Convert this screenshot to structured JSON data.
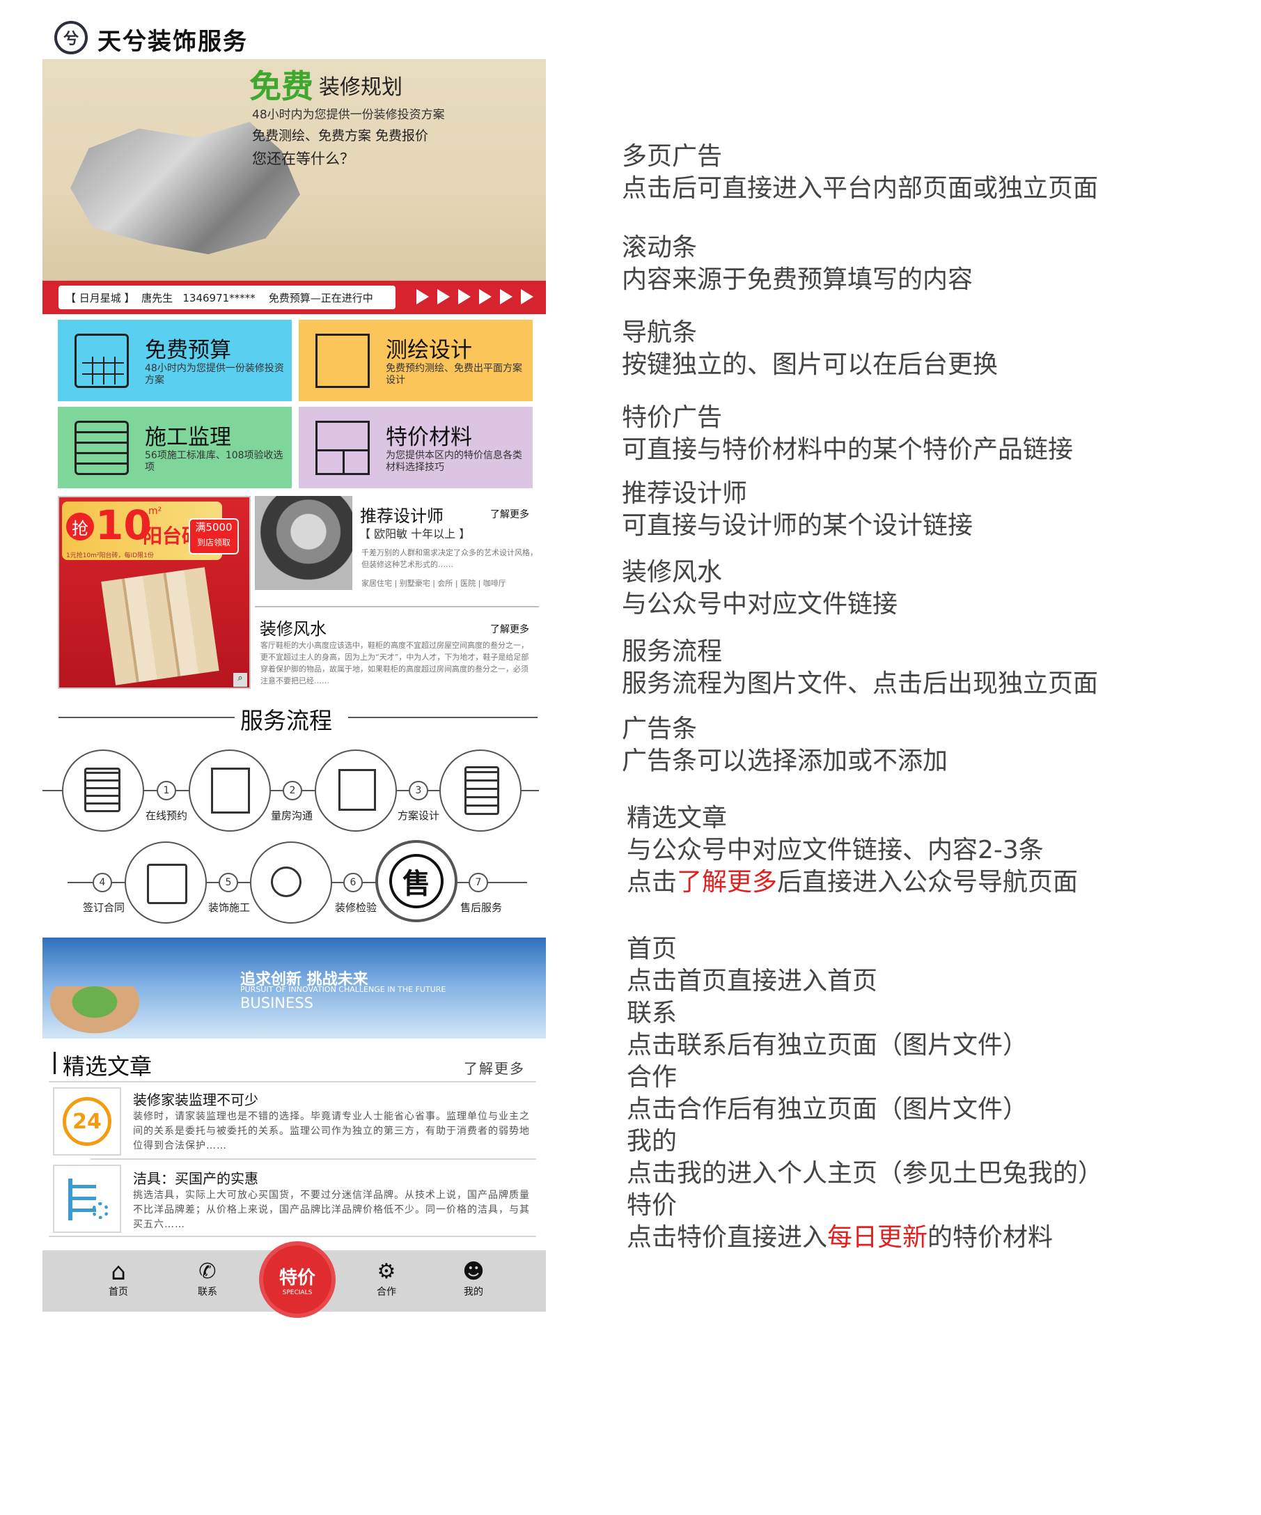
{
  "header": {
    "logo_char": "兮",
    "title": "天兮装饰服务"
  },
  "banner": {
    "title_green": "免费",
    "title_rest": "装修规划",
    "subtitle": "48小时内为您提供一份装修投资方案",
    "line1": "免费测绘、免费方案 免费报价",
    "line2": "您还在等什么？"
  },
  "ticker": {
    "text": "【 日月星城 】  唐先生   1346971*****    免费预算—正在进行中"
  },
  "nav_tiles": [
    {
      "title": "免费预算",
      "desc": "48小时内为您提供一份装修投资方案",
      "color": "#5ad0f0"
    },
    {
      "title": "测绘设计",
      "desc": "免费预约测绘、免费出平面方案设计",
      "color": "#fbc55a"
    },
    {
      "title": "施工监理",
      "desc": "56项施工标准库、108项验收选项",
      "color": "#7fd69a"
    },
    {
      "title": "特价材料",
      "desc": "为您提供本区内的特价信息各类材料选择技巧",
      "color": "#dcc5e3"
    }
  ],
  "promo": {
    "qiang": "抢",
    "num": "10",
    "unit": "m²",
    "product": "阳台砖",
    "badge": "满5000",
    "badge2": "到店领取",
    "fine": "1元抢10m²阳台砖，每ID限1份"
  },
  "designer": {
    "title": "推荐设计师",
    "more": "了解更多",
    "name": "【 欧阳敏 十年以上 】",
    "desc": "千差万别的人群和需求决定了众多的艺术设计风格，但装修这种艺术形式的……",
    "tags": "家居住宅 | 别墅豪宅 | 会所 | 医院 | 咖啡厅"
  },
  "fengshui": {
    "title": "装修风水",
    "more": "了解更多",
    "desc": "客厅鞋柜的大小高度应该选中，鞋柜的高度不宜超过房屋空间高度的叁分之一，更不宜超过主人的身高，因为上为“天才”，中为人才，下为地才，鞋子是给足部穿着保护脚的物品，故属于地，如果鞋柜的高度超过房间高度的叁分之一，必须注意不要把已经……"
  },
  "flow": {
    "title": "服务流程",
    "steps": [
      {
        "num": "1",
        "label": "在线预约"
      },
      {
        "num": "2",
        "label": "量房沟通"
      },
      {
        "num": "3",
        "label": "方案设计"
      },
      {
        "num": "4",
        "label": "签订合同"
      },
      {
        "num": "5",
        "label": "装饰施工"
      },
      {
        "num": "6",
        "label": "装修检验"
      },
      {
        "num": "7",
        "label": "售后服务"
      }
    ],
    "sale_char": "售"
  },
  "adbar": {
    "cn": "追求创新 挑战未来",
    "en1": "PURSUIT OF INNOVATION CHALLENGE IN THE FUTURE",
    "en2": "BUSINESS"
  },
  "articles": {
    "title": "精选文章",
    "more": "了解更多",
    "items": [
      {
        "icon_text": "24",
        "title": "装修家装监理不可少",
        "body": "装修时，请家装监理也是不错的选择。毕竟请专业人士能省心省事。监理单位与业主之间的关系是委托与被委托的关系。监理公司作为独立的第三方，有助于消费者的弱势地位得到合法保护……"
      },
      {
        "icon_text": "",
        "title": "洁具：买国产的实惠",
        "body": "挑选洁具，实际上大可放心买国货，不要过分迷信洋品牌。从技术上说，国产品牌质量不比洋品牌差；从价格上来说，国产品牌比洋品牌价格低不少。同一价格的洁具，与其买五六……"
      }
    ]
  },
  "bottom_nav": {
    "home": "首页",
    "contact": "联系",
    "special": "特价",
    "special_en": "SPECIALS",
    "coop": "合作",
    "mine": "我的"
  },
  "notes": [
    {
      "h": "多页广告",
      "p": "点击后可直接进入平台内部页面或独立页面"
    },
    {
      "h": "滚动条",
      "p": "内容来源于免费预算填写的内容"
    },
    {
      "h": "导航条",
      "p": "按键独立的、图片可以在后台更换"
    },
    {
      "h": "特价广告",
      "p": "可直接与特价材料中的某个特价产品链接"
    },
    {
      "h": "推荐设计师",
      "p": "可直接与设计师的某个设计链接"
    },
    {
      "h": "装修风水",
      "p": "与公众号中对应文件链接"
    },
    {
      "h": "服务流程",
      "p": "服务流程为图片文件、点击后出现独立页面"
    },
    {
      "h": "广告条",
      "p": "广告条可以选择添加或不添加"
    },
    {
      "h": "精选文章",
      "p": "与公众号中对应文件链接、内容2-3条",
      "p2a": "点击",
      "p2b": "了解更多",
      "p2c": "后直接进入公众号导航页面"
    },
    {
      "h": "首页",
      "p": "点击首页直接进入首页"
    },
    {
      "h": "联系",
      "p": "点击联系后有独立页面（图片文件）"
    },
    {
      "h": "合作",
      "p": "点击合作后有独立页面（图片文件）"
    },
    {
      "h": "我的",
      "p": "点击我的进入个人主页（参见土巴兔我的）"
    },
    {
      "h": "特价",
      "pa": "点击特价直接进入",
      "pb": "每日更新",
      "pc": "的特价材料"
    }
  ]
}
